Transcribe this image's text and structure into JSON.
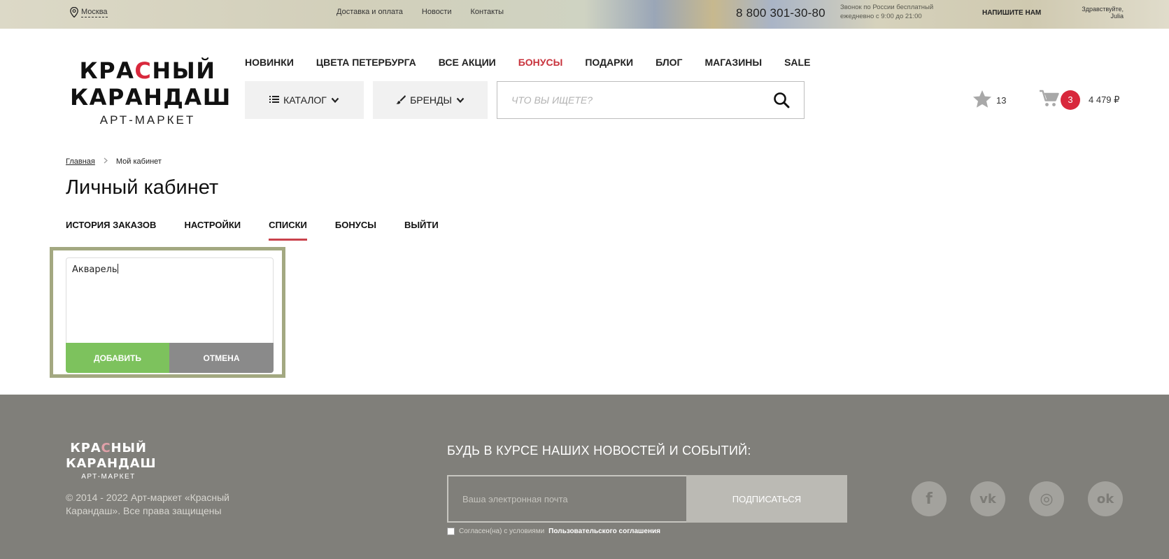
{
  "topbar": {
    "city": "Москва",
    "links": [
      "Доставка и оплата",
      "Новости",
      "Контакты"
    ],
    "phone": "8 800 301-30-80",
    "phone_note_1": "Звонок по России бесплатный",
    "phone_note_2": "ежедневно с 9:00 до 21:00",
    "write_us": "НАПИШИТЕ НАМ",
    "greeting": "Здравствуйте,",
    "user": "Julia"
  },
  "logo": {
    "line1_a": "КРА",
    "line1_dot": "С",
    "line1_b": "НЫЙ",
    "line2": "КАРАНДАШ",
    "line3": "АРТ-МАРКЕТ"
  },
  "mainnav": {
    "items": [
      "НОВИНКИ",
      "ЦВЕТА ПЕТЕРБУРГА",
      "ВСЕ АКЦИИ",
      "БОНУСЫ",
      "ПОДАРКИ",
      "БЛОГ",
      "МАГАЗИНЫ",
      "SALE"
    ]
  },
  "header": {
    "catalog_label": "КАТАЛОГ",
    "brands_label": "БРЕНДЫ",
    "search_placeholder": "ЧТО ВЫ ИЩЕТЕ?",
    "favorites_count": "13",
    "cart_count": "3",
    "cart_sum": "4 479 ₽"
  },
  "breadcrumb": {
    "home": "Главная",
    "current": "Мой кабинет"
  },
  "page": {
    "title": "Личный кабинет"
  },
  "tabs": [
    {
      "label": "ИСТОРИЯ ЗАКАЗОВ"
    },
    {
      "label": "НАСТРОЙКИ"
    },
    {
      "label": "СПИСКИ"
    },
    {
      "label": "БОНУСЫ"
    },
    {
      "label": "ВЫЙТИ"
    }
  ],
  "list_form": {
    "value": "Акварель",
    "add_label": "ДОБАВИТЬ",
    "cancel_label": "ОТМЕНА"
  },
  "footer": {
    "logo_line1_a": "КРА",
    "logo_line1_dot": "С",
    "logo_line1_b": "НЫЙ",
    "logo_line2": "КАРАНДАШ",
    "logo_line3": "АРТ-МАРКЕТ",
    "copyright": "© 2014 - 2022 Арт-маркет «Красный Карандаш». Все права защищены",
    "news_title": "БУДЬ В КУРСЕ НАШИХ НОВОСТЕЙ И СОБЫТИЙ:",
    "email_placeholder": "Ваша электронная почта",
    "subscribe_label": "ПОДПИСАТЬСЯ",
    "agree_text": "Согласен(на) с условиями",
    "agree_link": "Пользовательского соглашения",
    "socials": [
      {
        "icon": "facebook-icon",
        "glyph": "f"
      },
      {
        "icon": "vk-icon",
        "glyph": "vk"
      },
      {
        "icon": "instagram-icon",
        "glyph": "◎"
      },
      {
        "icon": "odnoklassniki-icon",
        "glyph": "ok"
      }
    ]
  },
  "colors": {
    "accent_red": "#d8283c",
    "add_green": "#7dc25d",
    "footer_bg": "#807f7a",
    "focus_border": "#a3a881"
  }
}
